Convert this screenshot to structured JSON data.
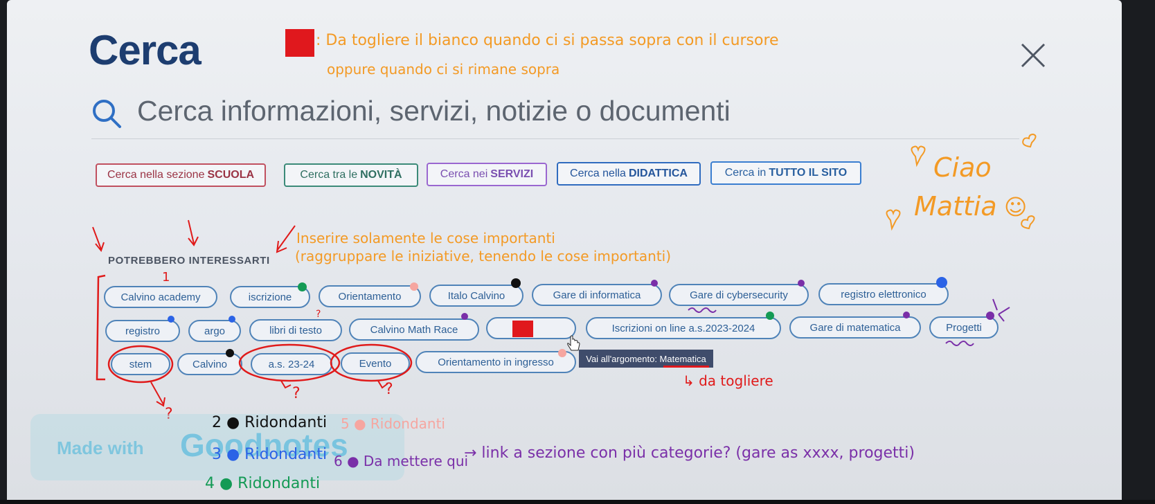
{
  "page": {
    "title": "Cerca",
    "search_placeholder": "Cerca informazioni, servizi, notizie o documenti"
  },
  "filters": [
    {
      "pre": "Cerca nella sezione",
      "bold": "SCUOLA",
      "color": "#c0505f",
      "text_color": "#9a3344"
    },
    {
      "pre": "Cerca tra le",
      "bold": "NOVITÀ",
      "color": "#3b8a78",
      "text_color": "#2f6f61"
    },
    {
      "pre": "Cerca nei",
      "bold": "SERVIZI",
      "color": "#9a67d0",
      "text_color": "#7a4fb0"
    },
    {
      "pre": "Cerca nella",
      "bold": "DIDATTICA",
      "color": "#2f6bbf",
      "text_color": "#24559b"
    },
    {
      "pre": "Cerca in",
      "bold": "TUTTO IL SITO",
      "color": "#3a7ed0",
      "text_color": "#285f9f"
    }
  ],
  "suggestions": {
    "heading": "POTREBBERO INTERESSARTI",
    "chips": [
      "Calvino academy",
      "iscrizione",
      "Orientamento",
      "Italo Calvino",
      "Gare di informatica",
      "Gare di cybersecurity",
      "registro elettronico",
      "registro",
      "argo",
      "libri di testo",
      "Calvino Math Race",
      "",
      "Iscrizioni on line a.s.2023-2024",
      "Gare di matematica",
      "Progetti",
      "stem",
      "Calvino",
      "a.s. 23-24",
      "Evento",
      "Orientamento in ingresso"
    ],
    "tooltip": "Vai all'argomento: Matematica"
  },
  "annotations": {
    "note_top_line1": ": Da togliere il bianco quando ci si passa sopra con il cursore",
    "note_top_line2": "oppure quando ci si rimane sopra",
    "note_important_1": "Inserire solamente le cose importanti",
    "note_important_2": "(raggruppare le iniziative, tenendo le cose importanti)",
    "greeting_1": "Ciao",
    "greeting_2": "Mattia",
    "greeting_smile": "☺",
    "number_1": "1",
    "remove_tooltip": "↳ da togliere",
    "q1": "?",
    "q2": "?",
    "q3": "?",
    "q4": "?",
    "legend_2": "2 ● Ridondanti",
    "legend_3": "3 ● Ridondanti",
    "legend_4": "4 ● Ridondanti",
    "legend_5": "5 ● Ridondanti",
    "legend_6": "6 ● Da mettere qui",
    "link_note": "→ link a sezione con più categorie? (gare as xxxx, progetti)"
  },
  "watermark": {
    "small": "Made with",
    "big": "Goodnotes"
  },
  "colors": {
    "accent_blue": "#1d3d70",
    "chip_border": "#4f83b8",
    "highlight_red": "#e0181d",
    "annotation_orange": "#f39a25",
    "annotation_purple": "#7a2fa8"
  }
}
